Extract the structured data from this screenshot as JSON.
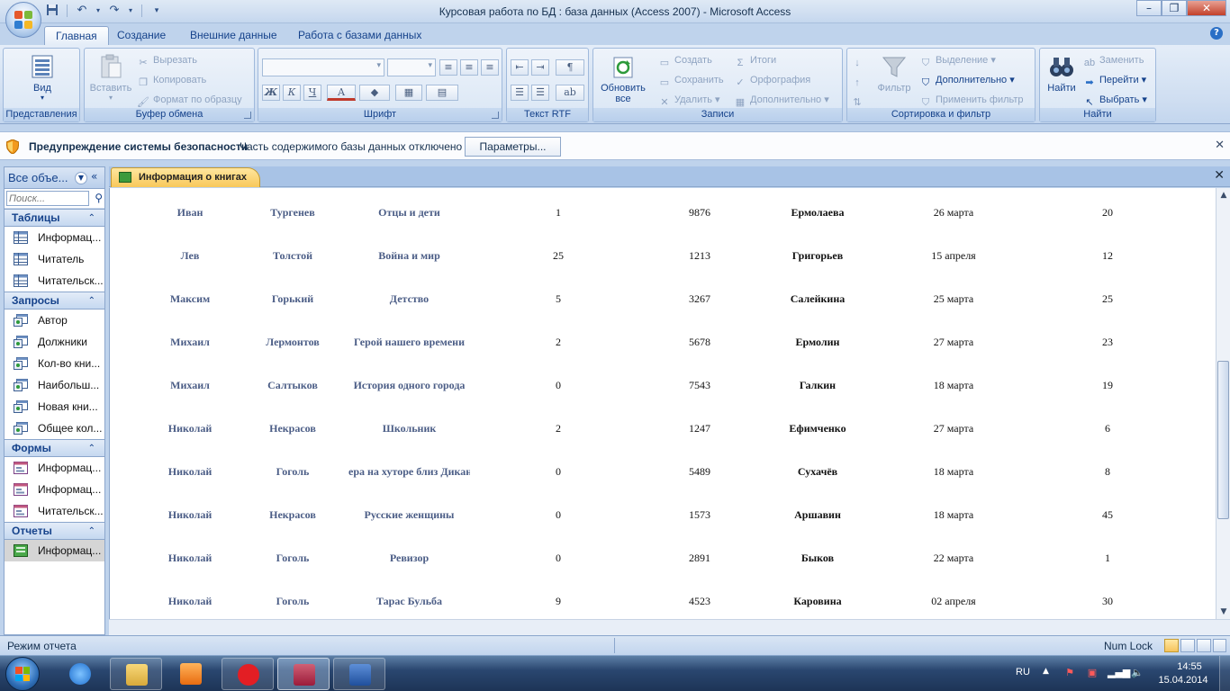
{
  "window": {
    "title": "Курсовая работа по БД : база данных (Access 2007) - Microsoft Access",
    "minimize": "–",
    "maximize": "❐",
    "close": "✕"
  },
  "ribbon_tabs": [
    "Главная",
    "Создание",
    "Внешние данные",
    "Работа с базами данных"
  ],
  "ribbon": {
    "views": {
      "label": "Представления",
      "view_button": "Вид"
    },
    "clipboard": {
      "label": "Буфер обмена",
      "paste": "Вставить",
      "cut": "Вырезать",
      "copy": "Копировать",
      "format_painter": "Формат по образцу"
    },
    "font": {
      "label": "Шрифт",
      "bold": "Ж",
      "italic": "К",
      "underline": "Ч",
      "font_color": "А"
    },
    "rtf": {
      "label": "Текст RTF"
    },
    "records": {
      "label": "Записи",
      "refresh_line1": "Обновить",
      "refresh_line2": "все",
      "new": "Создать",
      "save": "Сохранить",
      "delete": "Удалить",
      "totals": "Итоги",
      "spelling": "Орфография",
      "more": "Дополнительно"
    },
    "sort_filter": {
      "label": "Сортировка и фильтр",
      "filter": "Фильтр",
      "selection": "Выделение",
      "advanced": "Дополнительно",
      "toggle_filter": "Применить фильтр"
    },
    "find": {
      "label": "Найти",
      "find": "Найти",
      "replace": "Заменить",
      "goto": "Перейти",
      "select": "Выбрать"
    }
  },
  "security_bar": {
    "title": "Предупреждение системы безопасности",
    "message": "Часть содержимого базы данных отключено",
    "button": "Параметры..."
  },
  "nav_pane": {
    "header": "Все объе...",
    "search_placeholder": "Поиск...",
    "sections": [
      {
        "name": "Таблицы",
        "items": [
          "Информац...",
          "Читатель",
          "Читательск..."
        ]
      },
      {
        "name": "Запросы",
        "items": [
          "Автор",
          "Должники",
          "Кол-во кни...",
          "Наибольш...",
          "Новая кни...",
          "Общее кол..."
        ]
      },
      {
        "name": "Формы",
        "items": [
          "Информац...",
          "Информац...",
          "Читательск..."
        ]
      },
      {
        "name": "Отчеты",
        "items": [
          "Информац..."
        ]
      }
    ]
  },
  "document": {
    "tab_title": "Информация о книгах",
    "rows": [
      [
        "Иван",
        "Тургенев",
        "Отцы и дети",
        "1",
        "9876",
        "Ермолаева",
        "26 марта",
        "20"
      ],
      [
        "Лев",
        "Толстой",
        "Война и мир",
        "25",
        "1213",
        "Григорьев",
        "15 апреля",
        "12"
      ],
      [
        "Максим",
        "Горький",
        "Детство",
        "5",
        "3267",
        "Салейкина",
        "25 марта",
        "25"
      ],
      [
        "Михаил",
        "Лермонтов",
        "Герой нашего времени",
        "2",
        "5678",
        "Ермолин",
        "27 марта",
        "23"
      ],
      [
        "Михаил",
        "Салтыков",
        "История одного города",
        "0",
        "7543",
        "Галкин",
        "18 марта",
        "19"
      ],
      [
        "Николай",
        "Некрасов",
        "Школьник",
        "2",
        "1247",
        "Ефимченко",
        "27 марта",
        "6"
      ],
      [
        "Николай",
        "Гоголь",
        "ера на хуторе близ Дикан",
        "0",
        "5489",
        "Сухачёв",
        "18 марта",
        "8"
      ],
      [
        "Николай",
        "Некрасов",
        "Русские женщины",
        "0",
        "1573",
        "Аршавин",
        "18 марта",
        "45"
      ],
      [
        "Николай",
        "Гоголь",
        "Ревизор",
        "0",
        "2891",
        "Быков",
        "22 марта",
        "1"
      ],
      [
        "Николай",
        "Гоголь",
        "Тарас Бульба",
        "9",
        "4523",
        "Каровина",
        "02 апреля",
        "30"
      ]
    ]
  },
  "status_bar": {
    "mode": "Режим отчета",
    "numlock": "Num Lock"
  },
  "taskbar": {
    "language": "RU",
    "time": "14:55",
    "date": "15.04.2014",
    "apps": [
      "internet-explorer",
      "file-explorer",
      "media-player",
      "yandex-browser",
      "microsoft-access",
      "microsoft-word"
    ]
  },
  "colors": {
    "ribbon_bg": "#cfdef1",
    "accent": "#15428b",
    "report_tab": "#f8c85a"
  }
}
